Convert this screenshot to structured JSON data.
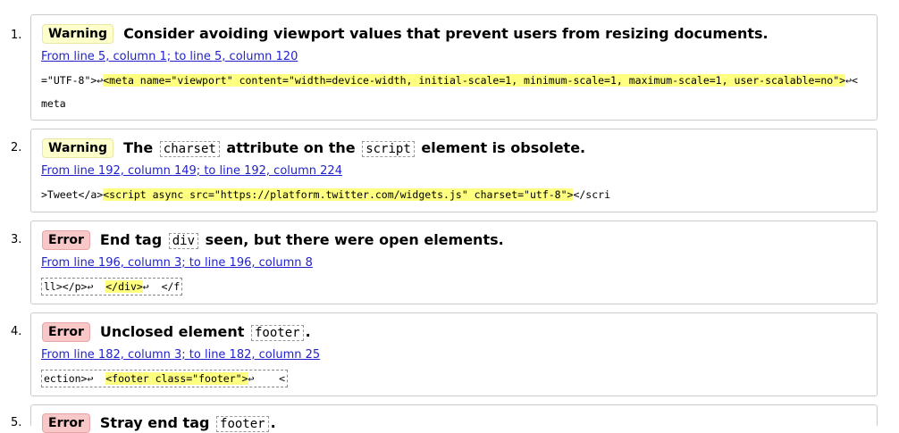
{
  "messages": [
    {
      "number": "1.",
      "type": "Warning",
      "message_parts": [
        "Consider avoiding viewport values that prevent users from resizing documents."
      ],
      "location": "From line 5, column 1; to line 5, column 120",
      "extract_before": "=\"UTF-8\">↩",
      "extract_highlight": "<meta name=\"viewport\" content=\"width=device-width, initial-scale=1, minimum-scale=1, maximum-scale=1, user-scalable=no\">",
      "extract_after": "↩<meta"
    },
    {
      "number": "2.",
      "type": "Warning",
      "message_pre": "The",
      "message_code": "charset",
      "message_mid": "attribute on the",
      "message_code2": "script",
      "message_post": "element is obsolete.",
      "location": "From line 192, column 149; to line 192, column 224",
      "extract_before": ">Tweet</a>",
      "extract_highlight": "<script async src=\"https://platform.twitter.com/widgets.js\" charset=\"utf-8\">",
      "extract_after": "</scri"
    },
    {
      "number": "3.",
      "type": "Error",
      "message_pre": "End tag",
      "message_code": "div",
      "message_post": "seen, but there were open elements.",
      "location": "From line 196, column 3; to line 196, column 8",
      "extract_before": "ll></p>↩  ",
      "extract_highlight": "</div>",
      "extract_after": "↩  </f"
    },
    {
      "number": "4.",
      "type": "Error",
      "message_pre": "Unclosed element",
      "message_code": "footer",
      "message_post": ".",
      "location": "From line 182, column 3; to line 182, column 25",
      "extract_before": "ection>↩  ",
      "extract_highlight": "<footer class=\"footer\">",
      "extract_after": "↩    <"
    },
    {
      "number": "5.",
      "type": "Error",
      "message_pre": "Stray end tag",
      "message_code": "footer",
      "message_post": "."
    }
  ]
}
